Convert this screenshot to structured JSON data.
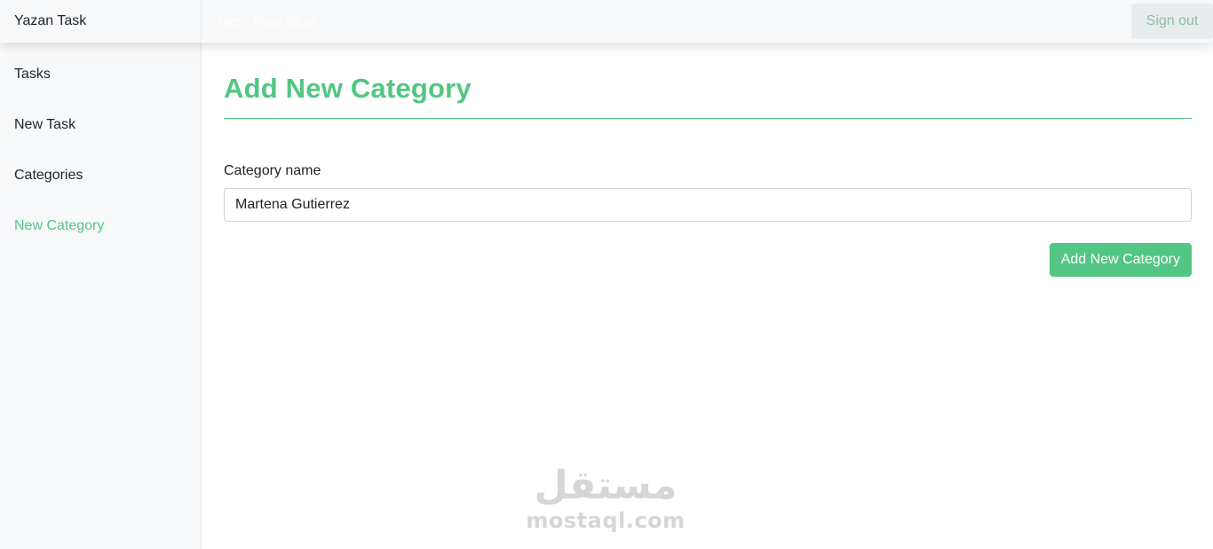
{
  "navbar": {
    "brand": "Yazan Task",
    "search_text": "Nigra Mapl allum",
    "signout_label": "Sign out"
  },
  "sidebar": {
    "items": [
      {
        "label": "Tasks"
      },
      {
        "label": "New Task"
      },
      {
        "label": "Categories"
      },
      {
        "label": "New Category"
      }
    ]
  },
  "main": {
    "title": "Add New Category",
    "field_label": "Category name",
    "field_value": "Martena Gutierrez",
    "submit_label": "Add New Category"
  },
  "watermark": {
    "arabic": "مستقل",
    "latin": "mostaql.com"
  },
  "colors": {
    "accent": "#52c682",
    "sidebar_bg": "#f8f9fa"
  }
}
